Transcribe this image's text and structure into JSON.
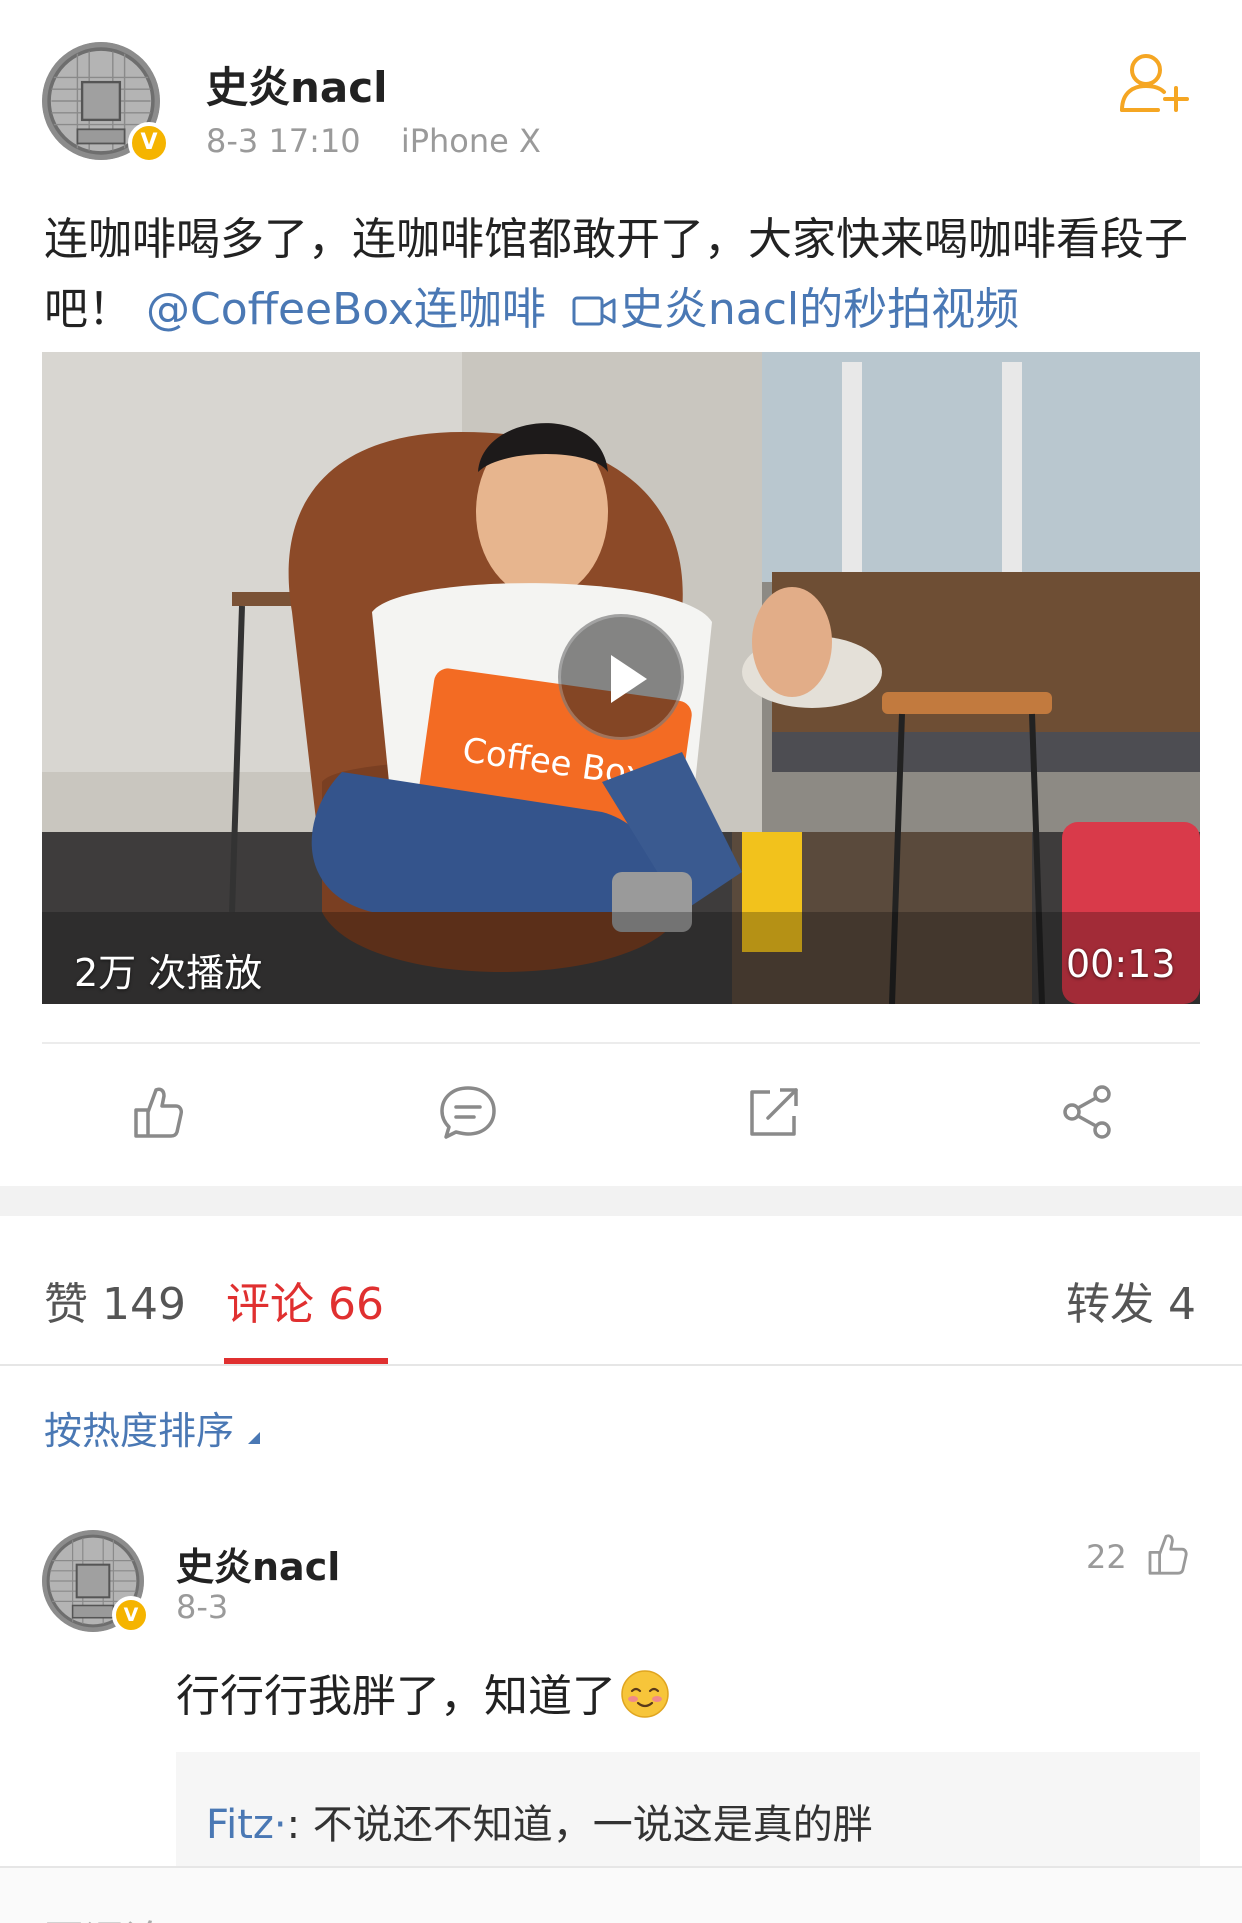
{
  "post": {
    "author": "史炎nacl",
    "time": "8-3 17:10",
    "device": "iPhone X",
    "text_main": "连咖啡喝多了，连咖啡馆都敢开了，大家快来喝咖啡看段子吧！",
    "mention": "@CoffeeBox连咖啡",
    "video_link": "史炎nacl的秒拍视频",
    "verified_badge": "V",
    "follow_icon": "add-user-icon"
  },
  "video": {
    "views": "2万 次播放",
    "duration": "00:13",
    "pillow_text": "Coffee Box"
  },
  "actions": [
    {
      "icon": "like-icon"
    },
    {
      "icon": "comment-icon"
    },
    {
      "icon": "repost-icon"
    },
    {
      "icon": "share-icon"
    }
  ],
  "tabs": {
    "likes": "赞 149",
    "comments": "评论 66",
    "reposts": "转发 4"
  },
  "sort": {
    "label": "按热度排序"
  },
  "comment": {
    "author": "史炎nacl",
    "date": "8-3",
    "likes": "22",
    "text": "行行行我胖了，知道了",
    "reply_author": "Fitz·",
    "reply_text": ": 不说还不知道，一说这是真的胖"
  },
  "bottom": {
    "placeholder": "写评论"
  },
  "colors": {
    "accent_red": "#e03030",
    "link_blue": "#4a78b4",
    "follow_orange": "#f5a623",
    "verified_gold": "#f5b400"
  }
}
